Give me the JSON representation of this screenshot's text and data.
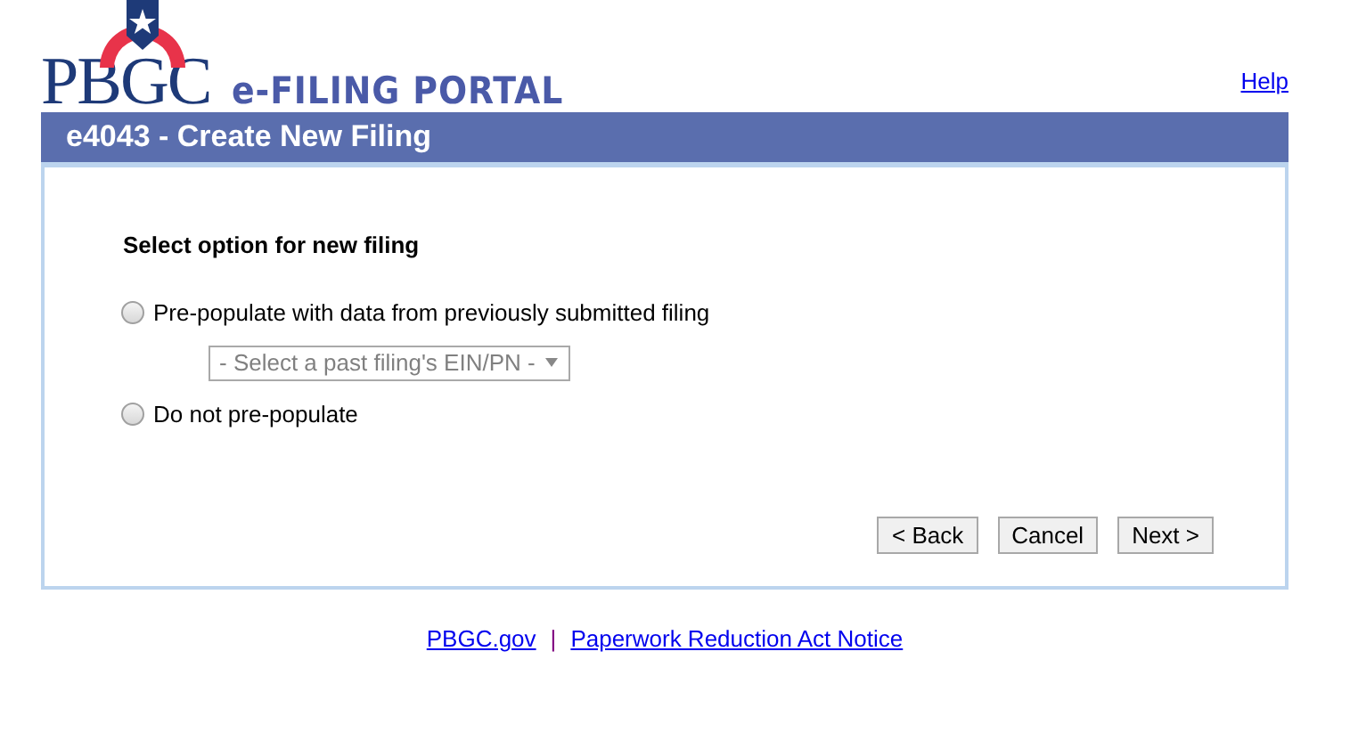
{
  "logo": {
    "name": "PBGC",
    "portal": "e-FILING PORTAL"
  },
  "help_link": "Help",
  "header": {
    "title": "e4043 - Create New Filing"
  },
  "form": {
    "heading": "Select option for new filing",
    "options": [
      {
        "kind": "radio",
        "label": "Pre-populate with data from previously submitted filing",
        "selected": false
      },
      {
        "kind": "select",
        "value": "- Select a past filing's EIN/PN -",
        "disabled": true
      },
      {
        "kind": "radio",
        "label": "Do not pre-populate",
        "selected": false
      }
    ]
  },
  "buttons": [
    "< Back",
    "Cancel",
    "Next >"
  ],
  "footer": {
    "links": [
      "PBGC.gov",
      "Paperwork Reduction Act Notice"
    ],
    "separator": "|"
  }
}
